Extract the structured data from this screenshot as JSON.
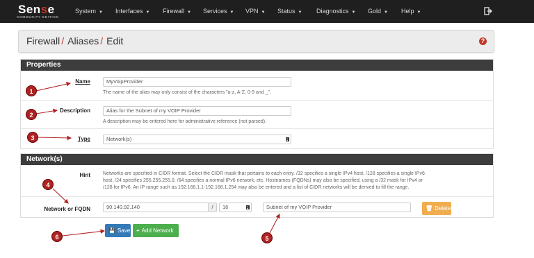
{
  "brand": {
    "name_a": "Sen",
    "name_o": "s",
    "name_b": "e",
    "tagline": "COMMUNITY EDITION"
  },
  "nav": [
    "System",
    "Interfaces",
    "Firewall",
    "Services",
    "VPN",
    "Status",
    "Diagnostics",
    "Gold",
    "Help"
  ],
  "breadcrumb": {
    "a": "Firewall",
    "b": "Aliases",
    "c": "Edit",
    "sep": "/",
    "help": "?"
  },
  "properties": {
    "title": "Properties",
    "name_label": "Name",
    "name_value": "MyVoipProvider",
    "name_help": "The name of the alias may only consist of the characters \"a-z, A-Z, 0-9 and _\".",
    "desc_label": "Description",
    "desc_value": "Alias for the Subnet of my VOIP Provider",
    "desc_help": "A description may be entered here for administrative reference (not parsed).",
    "type_label": "Type",
    "type_value": "Network(s)"
  },
  "networks": {
    "title": "Network(s)",
    "hint_label": "Hint",
    "hint_line1": "Networks are specified in CIDR format. Select the CIDR mask that pertains to each entry. /32 specifies a single IPv4 host, /128 specifies a single IPv6",
    "hint_line2": "host, /24 specifies 255.255.255.0, /64 specifies a normal IPv6 network, etc. Hostnames (FQDNs) may also be specified, using a /32 mask for IPv4 or",
    "hint_line3": "/128 for IPv6. An IP range such as 192.168.1.1-192.168.1.254 may also be entered and a list of CIDR networks will be derived to fill the range.",
    "row_label": "Network or FQDN",
    "address": "90.140.92.140",
    "slash": "/",
    "mask": "16",
    "entry_description": "Subnet of my VOIP Provider",
    "delete_label": "Delete"
  },
  "buttons": {
    "save": "Save",
    "add_network": "Add Network"
  },
  "annotations": [
    "1",
    "2",
    "3",
    "4",
    "5",
    "6"
  ],
  "colors": {
    "topbar": "#1f1f1f",
    "panel_head": "#3d3d3d",
    "accent_red": "#c0392b",
    "save_blue": "#337ab7",
    "add_green": "#4cae4c",
    "delete_orange": "#f0ad4e"
  }
}
